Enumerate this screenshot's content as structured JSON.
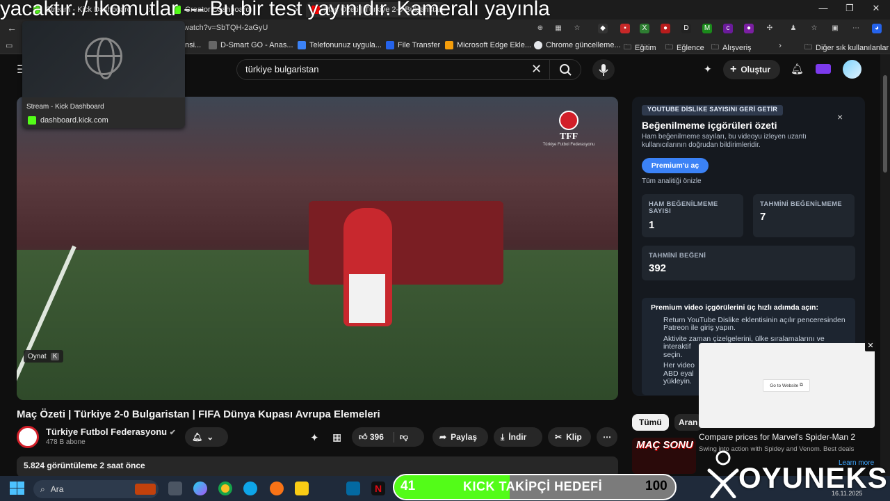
{
  "overlay": {
    "ticker": "yacaktır. / !komutlar --- Bu bir test yayınıdır. Kameralı yayınla"
  },
  "browser": {
    "tabs": [
      {
        "label": "Stream - Kick Dashboard",
        "color": "#53fc18"
      },
      {
        "label": "Creator Dashboard",
        "color": "#53fc18"
      },
      {
        "label": "Maç Özeti | Türkiye 2-0 Bulgaristan",
        "color": "#ff0000"
      }
    ],
    "url": "watch?v=SbTQH-2aGyU",
    "bookmarks": [
      {
        "label": "nsi..."
      },
      {
        "label": "D-Smart GO - Anas..."
      },
      {
        "label": "Telefonunuz uygula..."
      },
      {
        "label": "File Transfer"
      },
      {
        "label": "Microsoft Edge Ekle..."
      },
      {
        "label": "Chrome güncelleme..."
      },
      {
        "label": "Eğitim"
      },
      {
        "label": "Eğlence"
      },
      {
        "label": "Alışveriş"
      },
      {
        "label": "Diğer sık kullanılanlar"
      }
    ],
    "preview": {
      "title": "Stream - Kick Dashboard",
      "url": "dashboard.kick.com"
    }
  },
  "youtube": {
    "search_value": "türkiye bulgaristan",
    "create_label": "Oluştur",
    "player": {
      "tff_text": "TFF",
      "tff_sub": "Türkiye Futbol Federasyonu",
      "play_tip": "Oynat",
      "play_key": "K"
    },
    "video": {
      "title": "Maç Özeti | Türkiye 2-0 Bulgaristan | FIFA Dünya Kupası Avrupa Elemeleri",
      "channel": "Türkiye Futbol Federasyonu",
      "subs": "478 B abone",
      "likes": "396",
      "share": "Paylaş",
      "download": "İndir",
      "clip": "Klip",
      "views": "5.824 görüntüleme  2 saat önce"
    },
    "chips": {
      "all": "Tümü",
      "second": "Aran"
    },
    "thumb_text": "MAÇ SONU"
  },
  "dislike": {
    "badge": "YOUTUBE DİSLİKE SAYISINI GERİ GETİR",
    "title": "Beğenilmeme içgörüleri özeti",
    "desc": "Ham beğenilmeme sayıları, bu videoyu izleyen uzantı kullanıcılarının doğrudan bildirimleridir.",
    "premium_btn": "Premium'u aç",
    "preview_link": "Tüm analitiği önizle",
    "stats": [
      {
        "label": "HAM BEĞENİLMEME SAYISI",
        "value": "1"
      },
      {
        "label": "TAHMİNİ BEĞENİLMEME",
        "value": "7"
      },
      {
        "label": "TAHMİNİ BEĞENİ",
        "value": "392"
      }
    ],
    "steps_title": "Premium video içgörülerini üç hızlı adımda açın:",
    "steps": [
      "Return YouTube Dislike eklentisinin açılır penceresinden Patreon ile giriş yapın.",
      "Aktivite zaman çizelgelerini, ülke sıralamalarını ve interaktif",
      "seçin.",
      "Her video",
      "ABD eyal",
      "yükleyin."
    ]
  },
  "ad": {
    "go_label": "Go to Website",
    "title": "Compare prices for Marvel's Spider-Man 2",
    "sub": "Swing into action with Spidey and Venom. Best deals",
    "more": "Learn more"
  },
  "taskbar": {
    "search": "Ara",
    "clock": "16.11.2025"
  },
  "kick_goal": {
    "label": "KICK TAKİPÇİ HEDEFİ",
    "current": "41",
    "goal": "100",
    "progress": 0.41,
    "color": "#53fc18"
  },
  "brand": {
    "text": "OYUNEKS"
  }
}
